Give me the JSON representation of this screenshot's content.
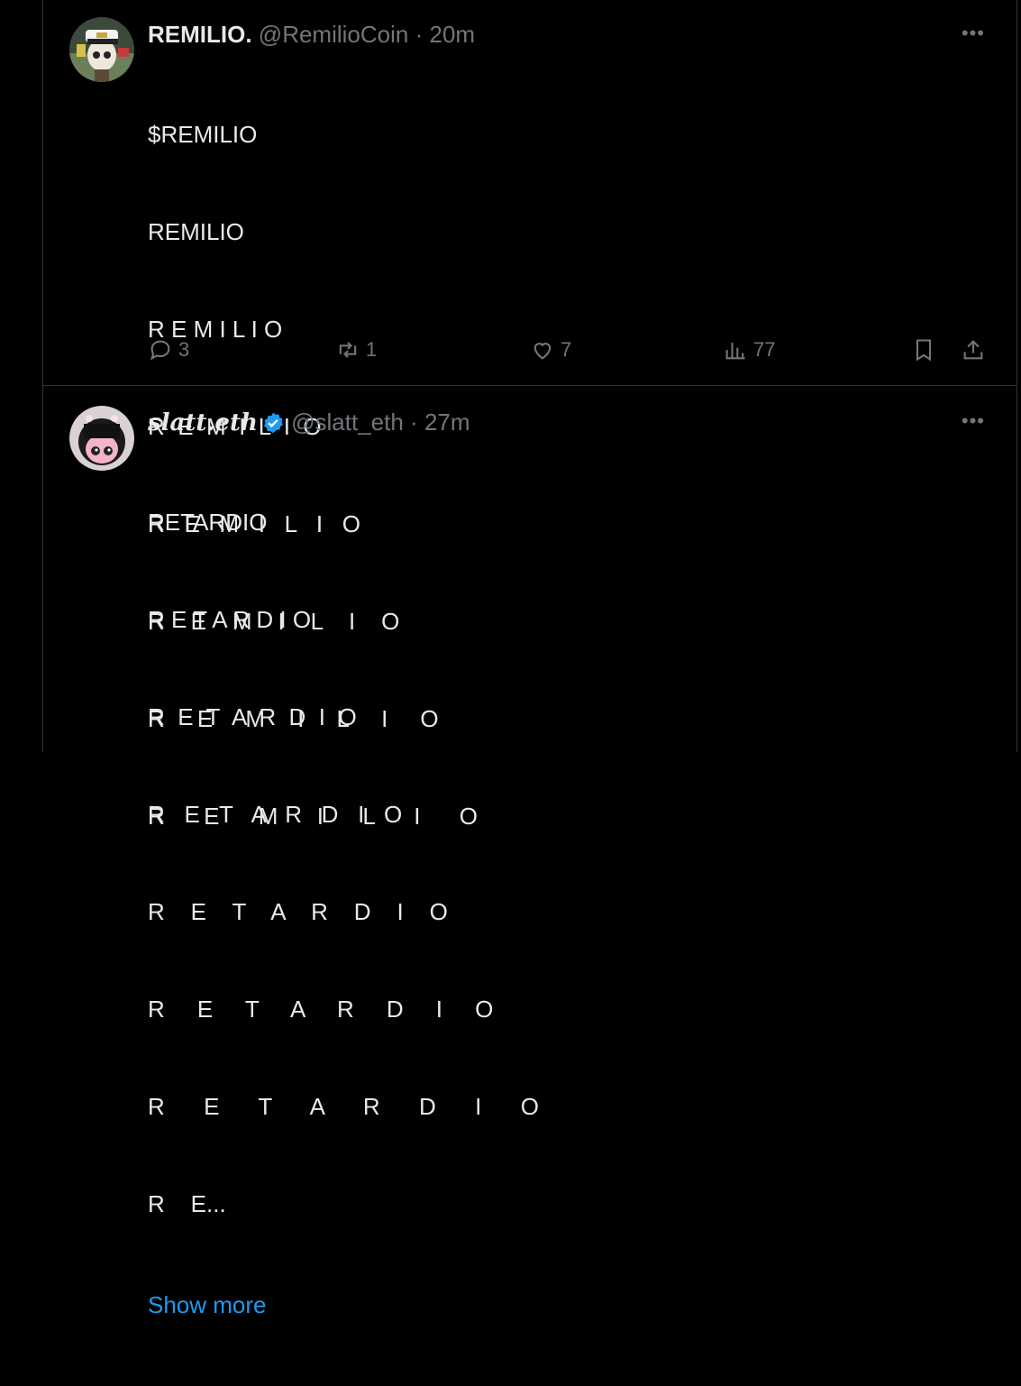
{
  "tweets": [
    {
      "display_name": "REMILIO.",
      "handle": "@RemilioCoin",
      "separator": "·",
      "time": "20m",
      "lines": [
        "$REMILIO",
        "REMILIO",
        "R E M I L I O",
        "R  E  M  I  L  I  O",
        "R   E   M   I   L   I   O",
        "R    E    M    I    L    I    O",
        "R     E     M     I     L     I     O",
        "R      E      M      I      L      I      O"
      ],
      "stats": {
        "replies": "3",
        "reposts": "1",
        "likes": "7",
        "views": "77"
      }
    },
    {
      "display_name": "slatt.eth",
      "handle": "@slatt_eth",
      "separator": "·",
      "time": "27m",
      "verified": true,
      "lines": [
        "RETARDIO",
        "R E T A R D I O",
        "R  E  T  A  R  D  I  O",
        "R   E   T   A   R   D   I   O",
        "R    E    T    A    R    D    I    O",
        "R     E     T     A     R     D     I     O",
        "R      E      T      A      R      D      I      O",
        "R    E..."
      ],
      "show_more": "Show more"
    }
  ],
  "more_label": "•••",
  "colors": {
    "accent": "#1d9bf0",
    "muted": "#71767b",
    "text": "#e7e9ea",
    "background": "#000000"
  }
}
